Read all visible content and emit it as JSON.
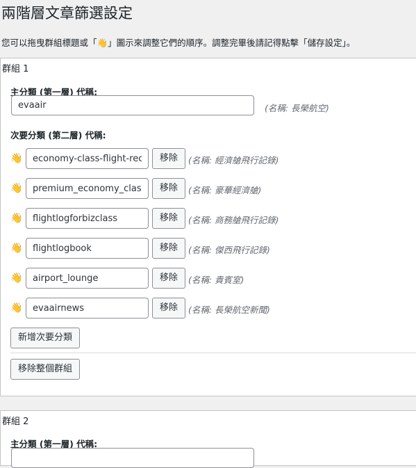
{
  "page": {
    "title": "兩階層文章篩選設定",
    "intro": "您可以拖曳群組標題或「👋」圖示來調整它們的順序。調整完畢後請記得點擊「儲存設定」。"
  },
  "groups": [
    {
      "label": "群組 1",
      "main_label": "主分類 (第一層) 代稱:",
      "main_value": "evaair",
      "main_note": "(名稱: 長榮航空)",
      "sub_label": "次要分類 (第二層) 代稱:",
      "subs": [
        {
          "value": "economy-class-flight-record",
          "note": "(名稱: 經濟艙飛行記錄)"
        },
        {
          "value": "premium_economy_class",
          "note": "(名稱: 豪華經濟艙)"
        },
        {
          "value": "flightlogforbizclass",
          "note": "(名稱: 商務艙飛行記錄)"
        },
        {
          "value": "flightlogbook",
          "note": "(名稱: 傑西飛行記錄)"
        },
        {
          "value": "airport_lounge",
          "note": "(名稱: 貴賓室)"
        },
        {
          "value": "evaairnews",
          "note": "(名稱: 長榮航空新聞)"
        }
      ],
      "remove_label": "移除",
      "add_sub_label": "新增次要分類",
      "remove_group_label": "移除整個群組"
    },
    {
      "label": "群組 2",
      "main_label": "主分類 (第一層) 代稱:"
    }
  ],
  "icons": {
    "drag_handle": "waving-hand-icon",
    "drag_color": "#f5b400"
  }
}
